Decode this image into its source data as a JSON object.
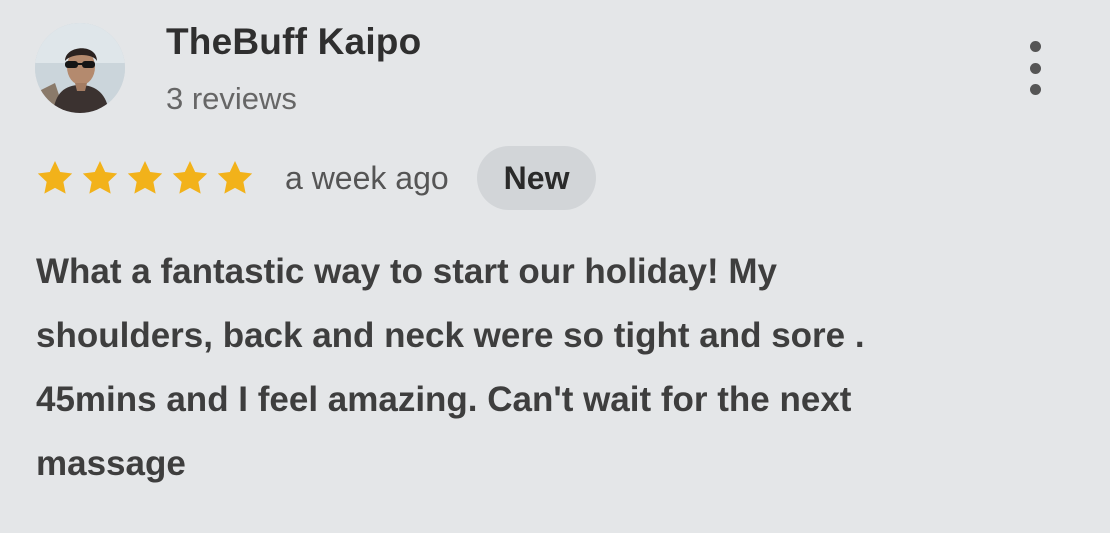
{
  "review": {
    "author": {
      "name": "TheBuff Kaipo",
      "review_count": "3 reviews",
      "avatar_icon": "user-avatar-photo"
    },
    "rating": 5,
    "max_rating": 5,
    "star_color": "#f2b21a",
    "timestamp": "a week ago",
    "badge": "New",
    "text": "What a fantastic way to start our holiday! My\nshoulders, back and neck were so tight and sore .\n45mins and I feel amazing. Can't wait for the next\nmassage",
    "menu_icon": "more-vert-icon"
  },
  "colors": {
    "background": "#e4e6e8",
    "badge_background": "#d2d5d8"
  }
}
